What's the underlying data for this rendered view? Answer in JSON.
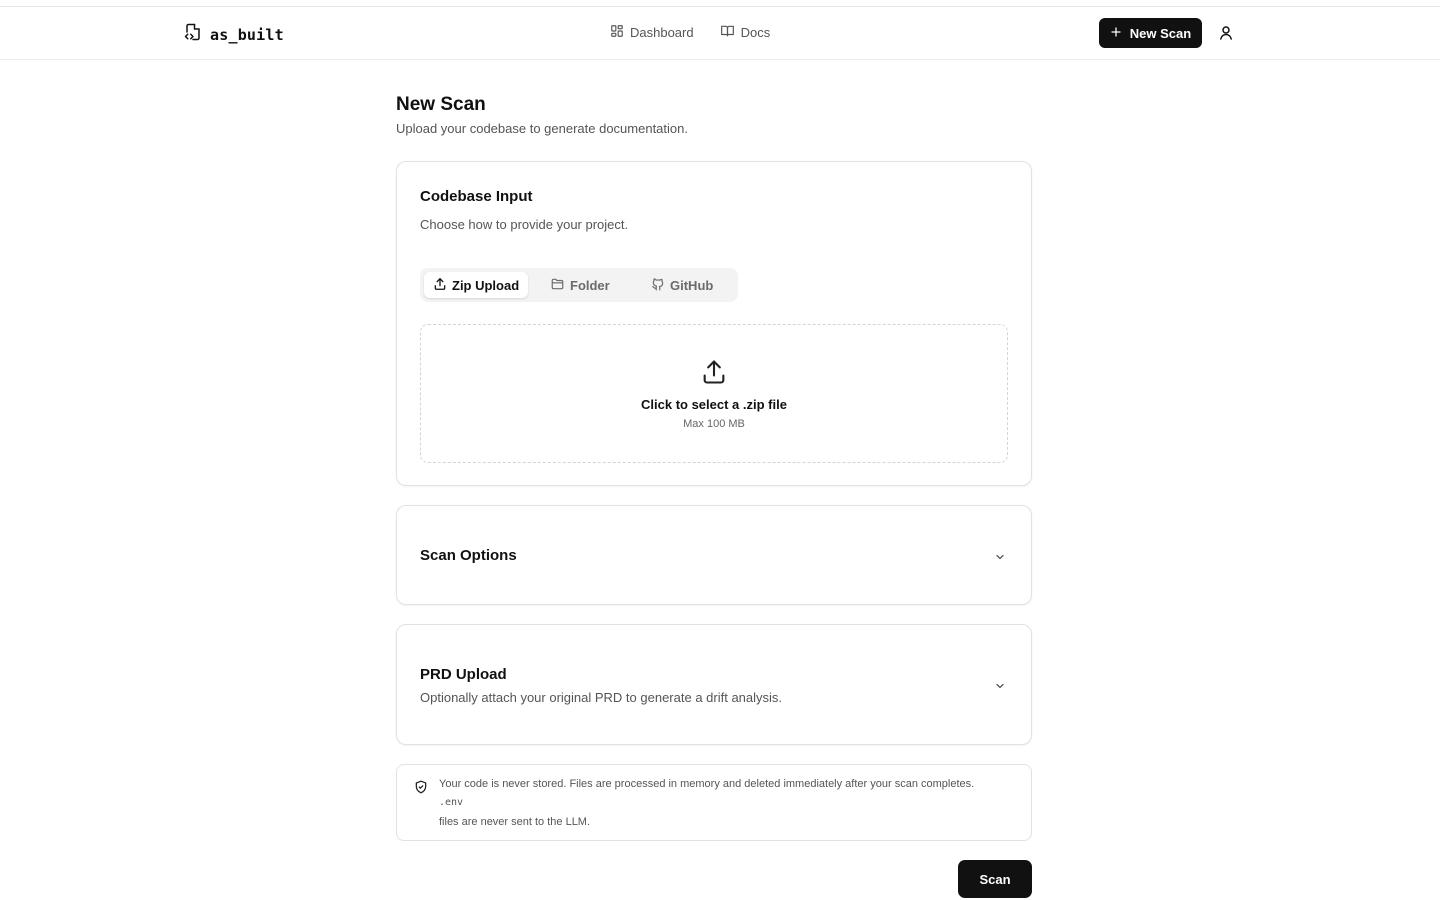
{
  "app": {
    "name": "as_built"
  },
  "nav": {
    "items": [
      {
        "label": "Dashboard",
        "icon": "grid-icon"
      },
      {
        "label": "Docs",
        "icon": "book-icon"
      }
    ],
    "new_scan_label": "New Scan"
  },
  "page": {
    "title": "New Scan",
    "subtitle": "Upload your codebase to generate documentation."
  },
  "codebase_input": {
    "title": "Codebase Input",
    "description": "Choose how to provide your project.",
    "tabs": [
      {
        "label": "Zip Upload",
        "icon": "upload-icon",
        "active": true
      },
      {
        "label": "Folder",
        "icon": "folder-icon",
        "active": false
      },
      {
        "label": "GitHub",
        "icon": "github-icon",
        "active": false
      }
    ],
    "dropzone": {
      "title": "Click to select a .zip file",
      "subtitle": "Max 100 MB"
    }
  },
  "scan_options": {
    "title": "Scan Options"
  },
  "prd_upload": {
    "title": "PRD Upload",
    "description": "Optionally attach your original PRD to generate a drift analysis."
  },
  "notice": {
    "line1": "Your code is never stored. Files are processed in memory and deleted immediately after your scan completes.",
    "code": ".env",
    "line2": "files are never sent to the LLM."
  },
  "actions": {
    "scan_label": "Scan"
  },
  "colors": {
    "accent": "#111111",
    "muted_text": "#555555",
    "border": "#e2e2e2"
  }
}
